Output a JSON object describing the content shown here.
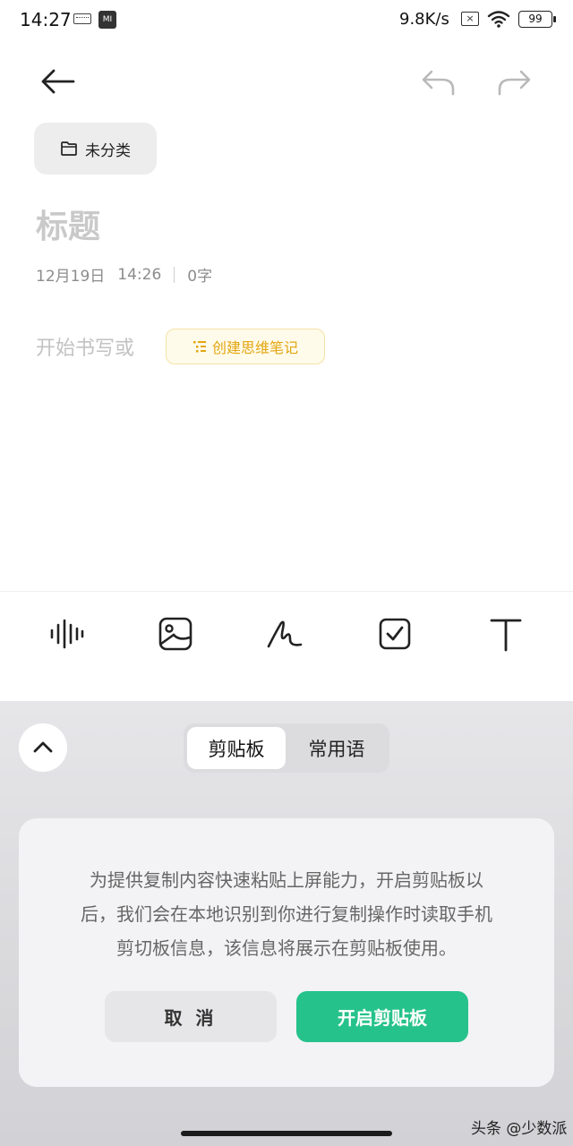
{
  "status_bar": {
    "time": "14:27",
    "mi_label": "MI",
    "network_speed": "9.8K/s",
    "sim_icon_label": "×",
    "battery": "99"
  },
  "note": {
    "category_label": "未分类",
    "title_placeholder": "标题",
    "date": "12月19日",
    "time": "14:26",
    "word_count": "0字",
    "body_placeholder": "开始书写或",
    "mind_note_label": "创建思维笔记"
  },
  "toolbar": {
    "items": [
      "voice-icon",
      "image-icon",
      "handwriting-icon",
      "checkbox-icon",
      "text-format-icon"
    ]
  },
  "clipboard": {
    "tabs": [
      "剪贴板",
      "常用语"
    ],
    "active_tab": "剪贴板",
    "prompt_lines": [
      "为提供复制内容快速粘贴上屏能力，开启剪贴板以",
      "后，我们会在本地识别到你进行复制操作时读取手机",
      "剪切板信息，该信息将展示在剪贴板使用。"
    ],
    "cancel_label": "取 消",
    "enable_label": "开启剪贴板"
  },
  "watermark": "头条 @少数派",
  "colors": {
    "accent_green": "#26c28b",
    "mind_chip_text": "#e2a611",
    "placeholder": "#c2c2c2"
  }
}
